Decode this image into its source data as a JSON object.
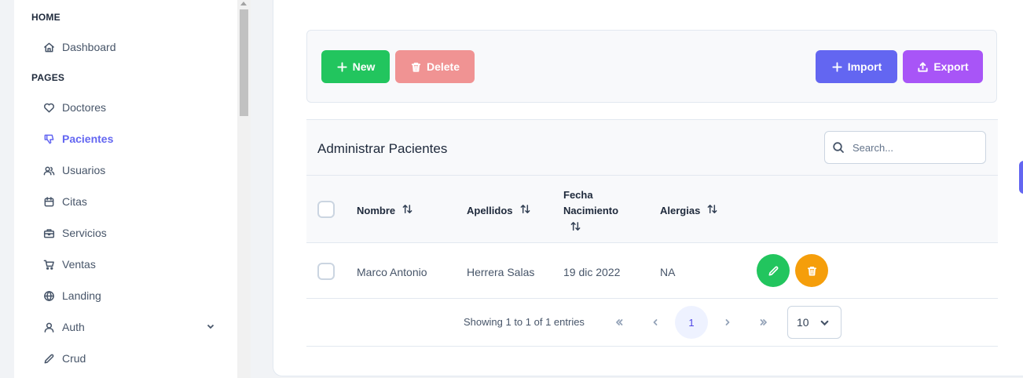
{
  "sidebar": {
    "sections": [
      {
        "title": "HOME"
      },
      {
        "title": "PAGES"
      }
    ],
    "items": [
      {
        "label": "Dashboard",
        "icon": "home-icon"
      },
      {
        "label": "Doctores",
        "icon": "heart-icon"
      },
      {
        "label": "Pacientes",
        "icon": "thumbs-down-icon",
        "active": true
      },
      {
        "label": "Usuarios",
        "icon": "users-icon"
      },
      {
        "label": "Citas",
        "icon": "calendar-icon"
      },
      {
        "label": "Servicios",
        "icon": "briefcase-icon"
      },
      {
        "label": "Ventas",
        "icon": "cart-icon"
      },
      {
        "label": "Landing",
        "icon": "globe-icon"
      },
      {
        "label": "Auth",
        "icon": "user-icon",
        "expandable": true
      },
      {
        "label": "Crud",
        "icon": "pencil-icon"
      }
    ]
  },
  "toolbar": {
    "new_label": "New",
    "delete_label": "Delete",
    "import_label": "Import",
    "export_label": "Export"
  },
  "table": {
    "title": "Administrar Pacientes",
    "search_placeholder": "Search...",
    "columns": [
      {
        "label": "Nombre"
      },
      {
        "label": "Apellidos"
      },
      {
        "label_line1": "Fecha",
        "label_line2": "Nacimiento"
      },
      {
        "label": "Alergias"
      }
    ],
    "rows": [
      {
        "nombre": "Marco Antonio",
        "apellidos": "Herrera Salas",
        "fecha": "19 dic 2022",
        "alergias": "NA"
      }
    ]
  },
  "pagination": {
    "summary": "Showing 1 to 1 of 1 entries",
    "current_page": "1",
    "rows_per_page": "10"
  },
  "colors": {
    "accent": "#6366f1",
    "new": "#22c55e",
    "delete": "#f09393",
    "import": "#6366f1",
    "export": "#a855f7",
    "row_edit": "#22c55e",
    "row_delete": "#f59e0b"
  }
}
